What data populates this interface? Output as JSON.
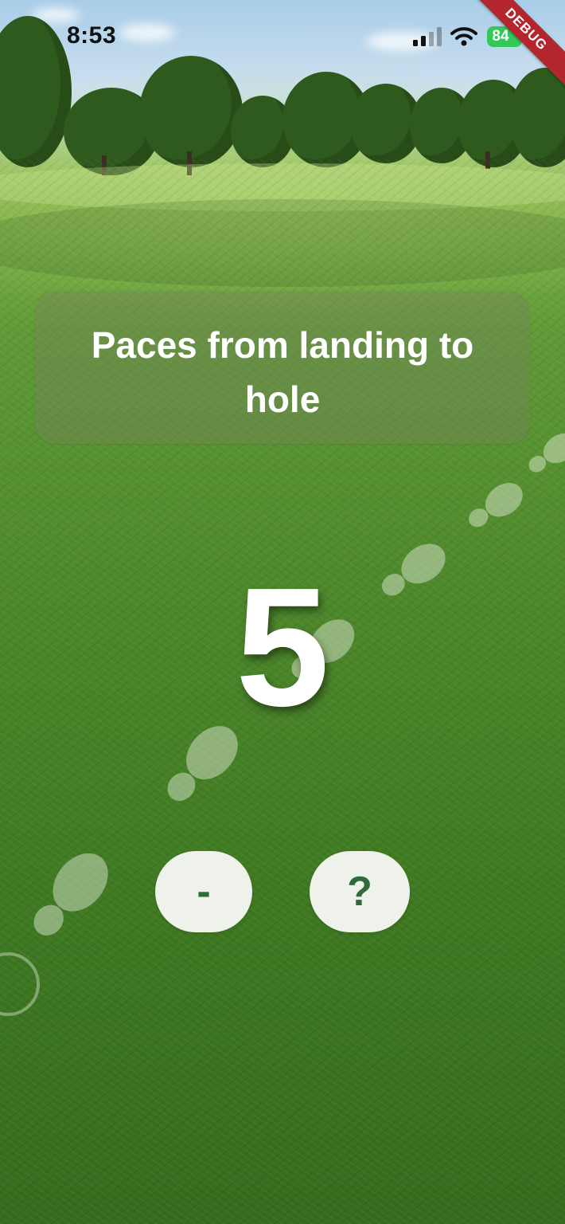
{
  "status_bar": {
    "time": "8:53",
    "battery": "84"
  },
  "debug_banner": "DEBUG",
  "prompt": "Paces from landing to hole",
  "pace_count": "5",
  "buttons": {
    "decrement": "-",
    "help": "?"
  },
  "colors": {
    "button_bg": "#eef2ea",
    "button_text": "#2f6a3a",
    "battery": "#34c759",
    "debug_ribbon": "#b3262e"
  },
  "icons": [
    "cellular-signal-icon",
    "wifi-icon",
    "battery-icon",
    "footprint-icon"
  ]
}
